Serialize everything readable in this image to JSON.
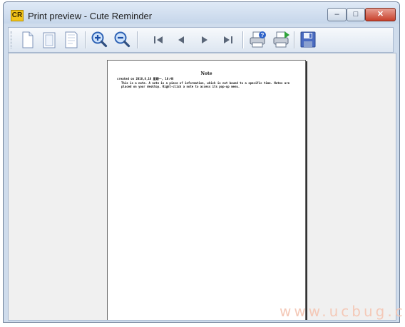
{
  "window": {
    "icon_text": "CR",
    "title": "Print preview - Cute Reminder",
    "controls": {
      "minimize": "–",
      "maximize": "□",
      "close": "✕"
    }
  },
  "toolbar": {
    "buttons": [
      {
        "icon": "page-single-icon"
      },
      {
        "icon": "page-double-icon"
      },
      {
        "icon": "page-multi-icon"
      },
      {
        "icon": "zoom-in-icon"
      },
      {
        "icon": "zoom-out-icon"
      },
      {
        "icon": "first-page-icon"
      },
      {
        "icon": "previous-page-icon"
      },
      {
        "icon": "next-page-icon"
      },
      {
        "icon": "last-page-icon"
      },
      {
        "icon": "print-setup-icon"
      },
      {
        "icon": "print-icon"
      },
      {
        "icon": "save-icon"
      }
    ]
  },
  "page": {
    "title": "Note",
    "date": "created on 2018,8,16 星期一, 10:48",
    "body": "This is a note. A note is a piece of information, which is not bound to a specific time. Notes are placed on your desktop. Right-click a note to access its pop-up menu."
  },
  "watermark": "www.ucbug.cc"
}
